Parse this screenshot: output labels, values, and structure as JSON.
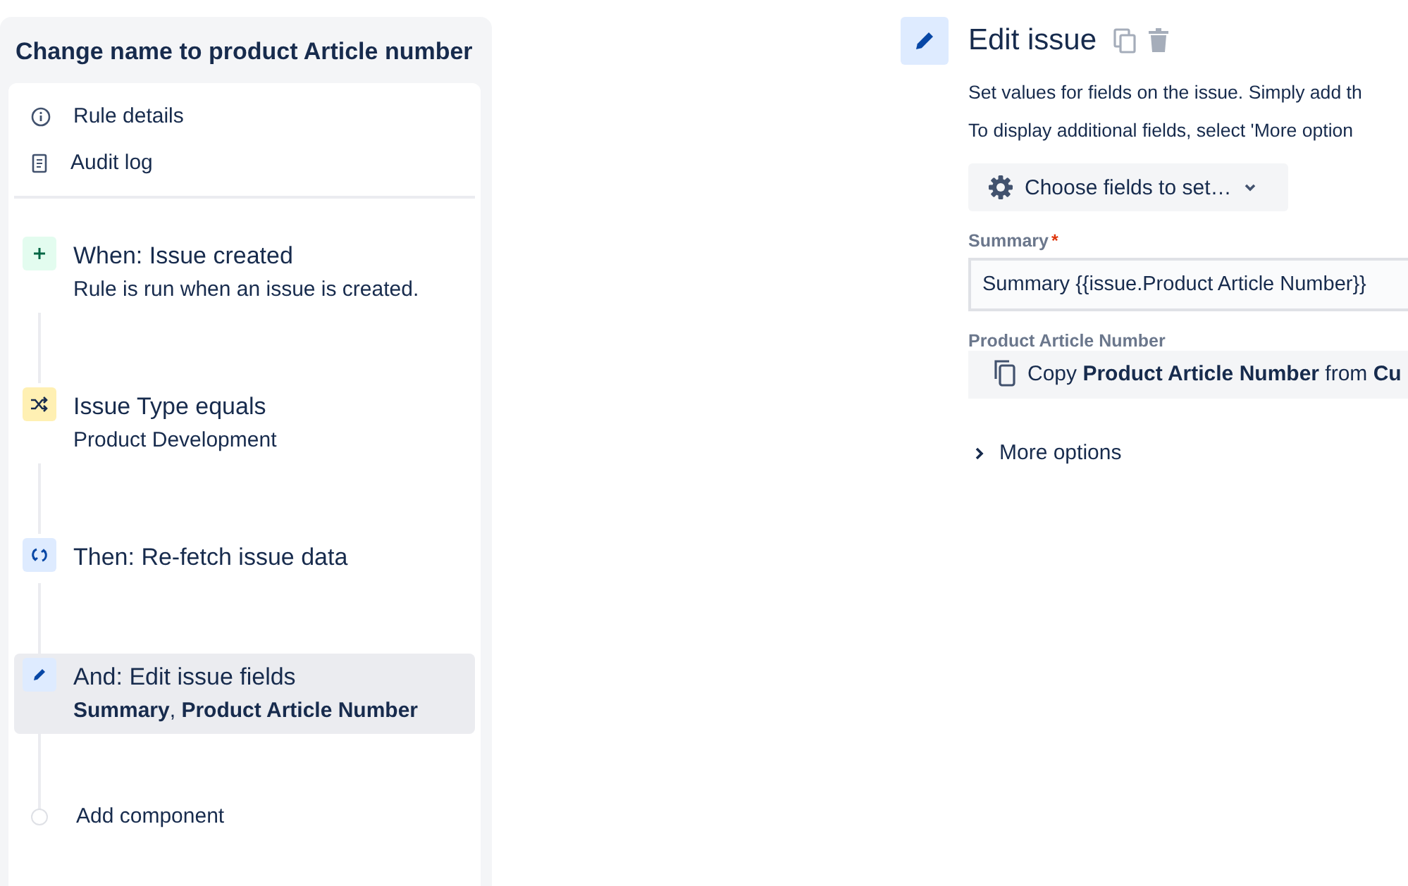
{
  "rule": {
    "title": "Change name to product Article number"
  },
  "nav": [
    {
      "kind": "info",
      "label": "Rule details"
    },
    {
      "kind": "log",
      "label": "Audit log"
    }
  ],
  "steps": [
    {
      "kind": "trigger",
      "title": "When: Issue created",
      "detail": "Rule is run when an issue is created.",
      "selected": false
    },
    {
      "kind": "condition",
      "title": "Issue Type equals",
      "detail": "Product Development",
      "selected": false
    },
    {
      "kind": "refetch",
      "title": "Then: Re-fetch issue data",
      "selected": false
    },
    {
      "kind": "edit",
      "title": "And: Edit issue fields",
      "detail": "**Summary**, **Product Article Number**",
      "selected": true
    }
  ],
  "add_component": "Add component",
  "editor": {
    "title": "Edit issue",
    "descriptions": [
      "Set values for fields on the issue. Simply add th",
      "To display additional fields, select 'More option"
    ],
    "choose_button": "Choose fields to set…",
    "fields": [
      {
        "kind": "text",
        "label": "Summary",
        "required_mark": "*",
        "value": "Summary {{issue.Product Article Number}}"
      },
      {
        "kind": "copy",
        "label": "Product Article Number",
        "value": "Copy **Product Article Number** from **Cu**"
      }
    ],
    "more_options": "More options"
  }
}
